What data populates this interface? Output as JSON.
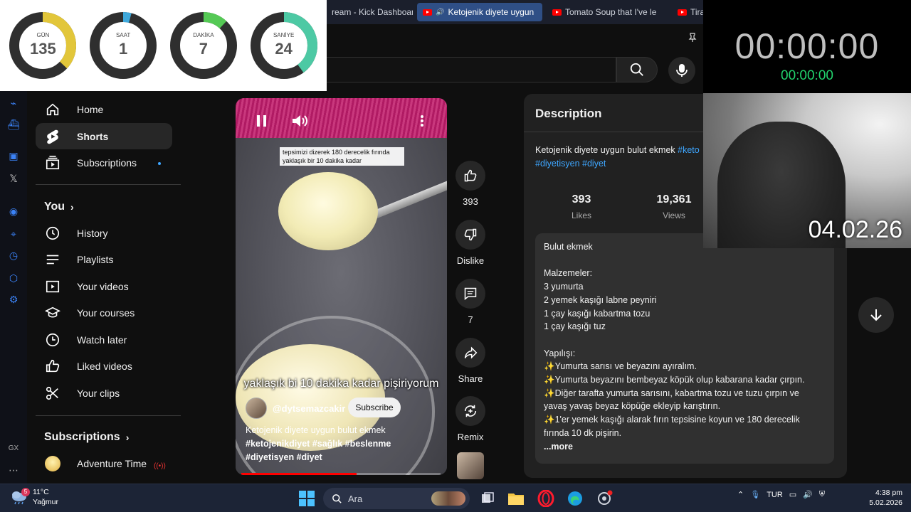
{
  "browser": {
    "tabs": [
      {
        "label": "ream - Kick Dashboard",
        "active": false
      },
      {
        "label": "Ketojenik diyete uygun",
        "active": true
      },
      {
        "label": "Tomato Soup that I've le",
        "active": false
      },
      {
        "label": "Tira",
        "active": false
      }
    ]
  },
  "counters": [
    {
      "label": "GÜN",
      "value": "135",
      "fraction": 0.37,
      "color": "#e2c63a"
    },
    {
      "label": "SAAT",
      "value": "1",
      "fraction": 0.04,
      "color": "#3fa9dc"
    },
    {
      "label": "DAKİKA",
      "value": "7",
      "fraction": 0.12,
      "color": "#55c955"
    },
    {
      "label": "SANİYE",
      "value": "24",
      "fraction": 0.4,
      "color": "#4dc9a4"
    }
  ],
  "timer": {
    "big": "00:00:00",
    "small": "00:00:00"
  },
  "webcam": {
    "date": "04.02.26"
  },
  "sidebar": {
    "items": [
      {
        "label": "Home",
        "icon": "home-icon"
      },
      {
        "label": "Shorts",
        "icon": "shorts-icon"
      },
      {
        "label": "Subscriptions",
        "icon": "subscriptions-icon"
      }
    ],
    "you_heading": "You",
    "you_items": [
      {
        "label": "History",
        "icon": "history-icon"
      },
      {
        "label": "Playlists",
        "icon": "playlists-icon"
      },
      {
        "label": "Your videos",
        "icon": "your-videos-icon"
      },
      {
        "label": "Your courses",
        "icon": "courses-icon"
      },
      {
        "label": "Watch later",
        "icon": "watch-later-icon"
      },
      {
        "label": "Liked videos",
        "icon": "liked-icon"
      },
      {
        "label": "Your clips",
        "icon": "clips-icon"
      }
    ],
    "subscriptions_heading": "Subscriptions",
    "subscriptions": [
      {
        "label": "Adventure Time",
        "live": true
      }
    ]
  },
  "video": {
    "overlay_caption": "tepsimizi dizerek 180 derecelik fırında yaklaşık bir 10 dakika kadar",
    "big_caption": "yaklaşık bi 10 dakika kadar pişiriyorum",
    "channel": "@dytsemazcakir",
    "subscribe_label": "Subscribe",
    "title_line": "Ketojenik diyete uygun bulut ekmek",
    "tags_line1": "#ketojenikdiyet #sağlık #beslenme",
    "tags_line2": "#diyetisyen #diyet",
    "progress": 0.58
  },
  "actions": {
    "like_count": "393",
    "dislike_label": "Dislike",
    "comment_count": "7",
    "share_label": "Share",
    "remix_label": "Remix"
  },
  "description": {
    "title": "Description",
    "headline_text": "Ketojenik diyete uygun bulut ekmek ",
    "headline_tag1": "#keto",
    "headline_tags2": "#diyetisyen #diyet",
    "likes": "393",
    "likes_label": "Likes",
    "views": "19,361",
    "views_label": "Views",
    "recipe": [
      "Bulut ekmek",
      "",
      "Malzemeler:",
      "3 yumurta",
      "2 yemek kaşığı labne peyniri",
      "1 çay kaşığı kabartma tozu",
      "1 çay kaşığı tuz",
      "",
      "Yapılışı:",
      "✨Yumurta sarısı ve beyazını ayıralım.",
      "✨Yumurta beyazını bembeyaz köpük olup kabarana kadar çırpın.",
      "✨Diğer tarafta yumurta sarısını, kabartma tozu ve tuzu çırpın ve",
      "yavaş yavaş beyaz köpüğe ekleyip karıştırın.",
      "✨1'er yemek kaşığı alarak fırın tepsisine koyun ve 180 derecelik",
      "fırında 10 dk pişirin."
    ],
    "more_label": "...more"
  },
  "taskbar": {
    "weather_temp": "11°C",
    "weather_desc": "Yağmur",
    "weather_badge": "5",
    "search_placeholder": "Ara",
    "lang": "TUR",
    "time": "4:38 pm",
    "date": "5.02.2026"
  }
}
